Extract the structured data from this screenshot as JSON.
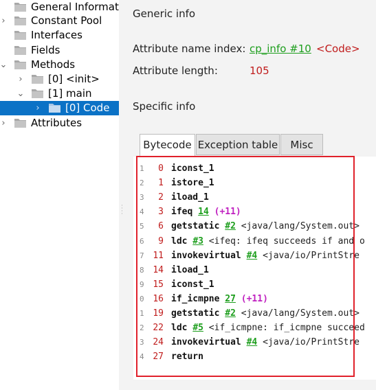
{
  "tree": {
    "items": [
      {
        "label": "General Informati",
        "chevron": "",
        "indent": 0
      },
      {
        "label": "Constant Pool",
        "chevron": "›",
        "indent": 0
      },
      {
        "label": "Interfaces",
        "chevron": "",
        "indent": 0
      },
      {
        "label": "Fields",
        "chevron": "",
        "indent": 0
      },
      {
        "label": "Methods",
        "chevron": "⌄",
        "indent": 0
      },
      {
        "label": "[0] <init>",
        "chevron": "›",
        "indent": 1
      },
      {
        "label": "[1] main",
        "chevron": "⌄",
        "indent": 1
      },
      {
        "label": "[0] Code",
        "chevron": "›",
        "indent": 2,
        "selected": true
      },
      {
        "label": "Attributes",
        "chevron": "›",
        "indent": 0
      }
    ]
  },
  "right": {
    "generic_title": "Generic info",
    "name_index_label": "Attribute name index:",
    "name_index_link": "cp_info #10",
    "name_index_value": "<Code>",
    "length_label": "Attribute length:",
    "length_value": "105",
    "specific_title": "Specific info"
  },
  "tabs": [
    {
      "label": "Bytecode",
      "active": true
    },
    {
      "label": "Exception table",
      "active": false
    },
    {
      "label": "Misc",
      "active": false
    }
  ],
  "code": {
    "lines": [
      {
        "num": "1",
        "offset": "0",
        "op": "iconst_1",
        "ref": "",
        "comment": "",
        "jump": ""
      },
      {
        "num": "2",
        "offset": "1",
        "op": "istore_1",
        "ref": "",
        "comment": "",
        "jump": ""
      },
      {
        "num": "3",
        "offset": "2",
        "op": "iload_1",
        "ref": "",
        "comment": "",
        "jump": ""
      },
      {
        "num": "4",
        "offset": "3",
        "op": "ifeq",
        "ref": "14",
        "comment": "",
        "jump": "(+11)"
      },
      {
        "num": "5",
        "offset": "6",
        "op": "getstatic",
        "ref": "#2",
        "comment": "<java/lang/System.out>",
        "jump": ""
      },
      {
        "num": "6",
        "offset": "9",
        "op": "ldc",
        "ref": "#3",
        "comment": "<ifeq: ifeq succeeds if and o",
        "jump": ""
      },
      {
        "num": "7",
        "offset": "11",
        "op": "invokevirtual",
        "ref": "#4",
        "comment": "<java/io/PrintStre",
        "jump": ""
      },
      {
        "num": "8",
        "offset": "14",
        "op": "iload_1",
        "ref": "",
        "comment": "",
        "jump": ""
      },
      {
        "num": "9",
        "offset": "15",
        "op": "iconst_1",
        "ref": "",
        "comment": "",
        "jump": ""
      },
      {
        "num": "0",
        "offset": "16",
        "op": "if_icmpne",
        "ref": "27",
        "comment": "",
        "jump": "(+11)"
      },
      {
        "num": "1",
        "offset": "19",
        "op": "getstatic",
        "ref": "#2",
        "comment": "<java/lang/System.out>",
        "jump": ""
      },
      {
        "num": "2",
        "offset": "22",
        "op": "ldc",
        "ref": "#5",
        "comment": "<if_icmpne: if_icmpne succeed",
        "jump": ""
      },
      {
        "num": "3",
        "offset": "24",
        "op": "invokevirtual",
        "ref": "#4",
        "comment": "<java/io/PrintStre",
        "jump": ""
      },
      {
        "num": "4",
        "offset": "27",
        "op": "return",
        "ref": "",
        "comment": "",
        "jump": ""
      }
    ]
  },
  "colors": {
    "selection": "#0b72c6",
    "link_green": "#1d9e1d",
    "value_red": "#c01c1c",
    "jump_magenta": "#c020c0",
    "highlight_box": "#e0202a"
  },
  "icons": {
    "folder": "folder-icon",
    "chevron_right": "chevron-right-icon",
    "chevron_down": "chevron-down-icon"
  }
}
